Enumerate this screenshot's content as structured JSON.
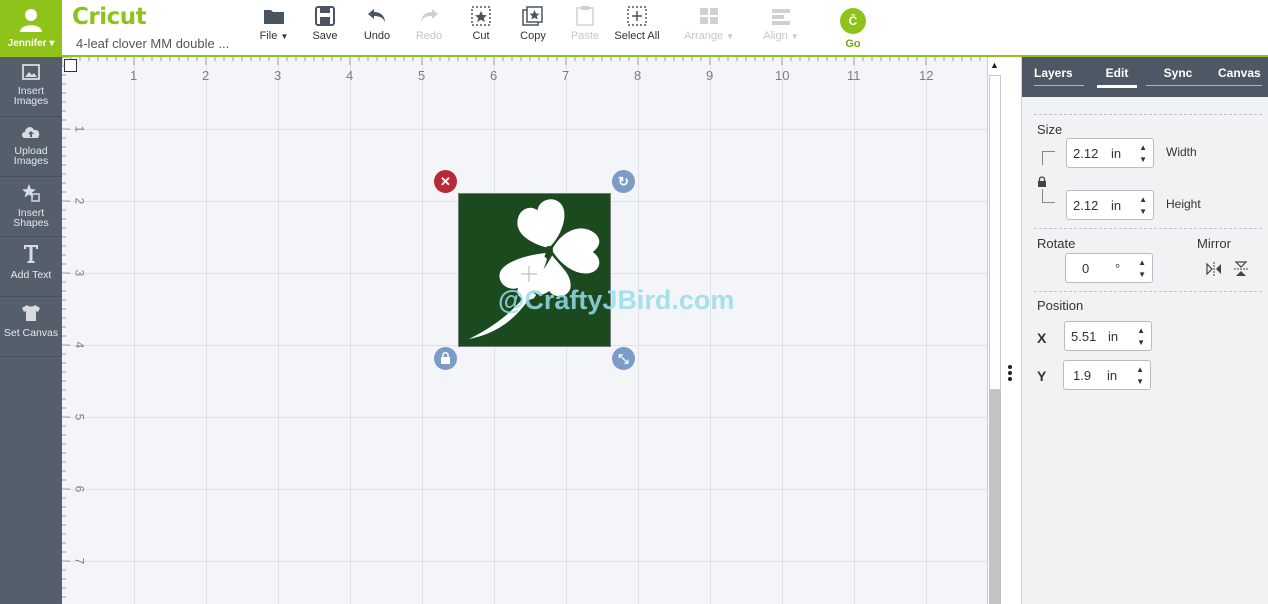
{
  "user": {
    "name": "Jennifer"
  },
  "app": {
    "logo": "Cricut",
    "project_name": "4-leaf clover MM double ..."
  },
  "toolbar": {
    "file": "File",
    "save": "Save",
    "undo": "Undo",
    "redo": "Redo",
    "cut": "Cut",
    "copy": "Copy",
    "paste": "Paste",
    "select_all": "Select All",
    "arrange": "Arrange",
    "align": "Align",
    "go": "Go"
  },
  "sidebar": {
    "items": [
      {
        "label1": "Insert",
        "label2": "Images"
      },
      {
        "label1": "Upload",
        "label2": "Images"
      },
      {
        "label1": "Insert",
        "label2": "Shapes"
      },
      {
        "label1": "Add Text",
        "label2": ""
      },
      {
        "label1": "Set Canvas",
        "label2": ""
      }
    ]
  },
  "canvas": {
    "ruler_top": [
      "1",
      "2",
      "3",
      "4",
      "5",
      "6",
      "7",
      "8",
      "9",
      "10",
      "11",
      "12"
    ],
    "ruler_left": [
      "1",
      "2",
      "3",
      "4",
      "5",
      "6",
      "7"
    ],
    "watermark": "@CraftyJBird.com"
  },
  "panel": {
    "tabs": [
      "Layers",
      "Edit",
      "Sync",
      "Canvas"
    ],
    "size": {
      "title": "Size",
      "width_value": "2.12",
      "width_unit": "in",
      "width_label": "Width",
      "height_value": "2.12",
      "height_unit": "in",
      "height_label": "Height"
    },
    "rotate": {
      "title": "Rotate",
      "value": "0",
      "unit": "°"
    },
    "mirror": {
      "title": "Mirror"
    },
    "position": {
      "title": "Position",
      "x_label": "X",
      "x_value": "5.51",
      "x_unit": "in",
      "y_label": "Y",
      "y_value": "1.9",
      "y_unit": "in"
    }
  },
  "colors": {
    "brand_green": "#8fc21a",
    "sidebar": "#545f6b",
    "image_bg": "#1c4a1f",
    "delete_handle": "#b82a3a",
    "handle_blue": "#7b9cc7"
  }
}
